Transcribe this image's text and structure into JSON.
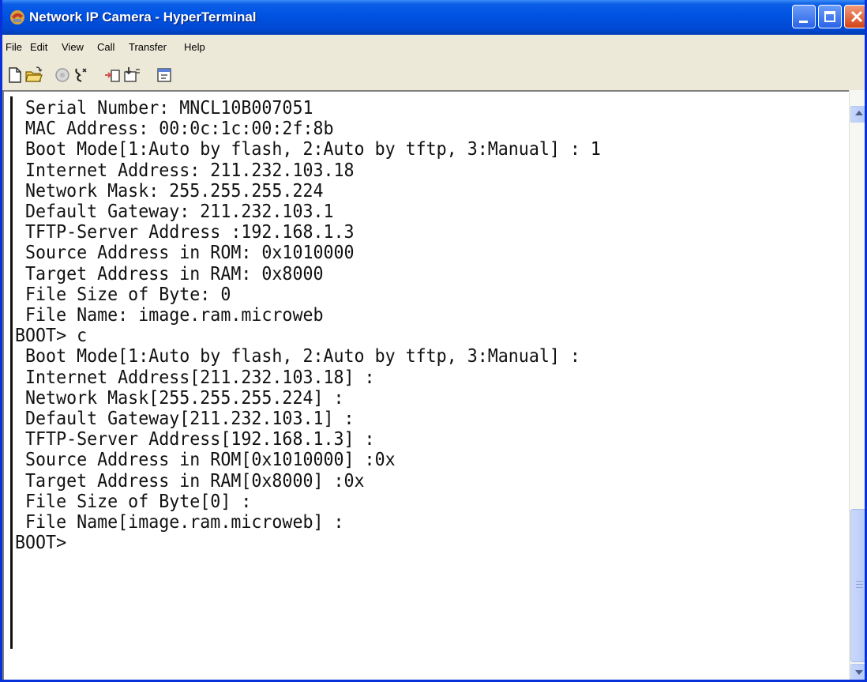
{
  "window": {
    "title": "Network IP Camera - HyperTerminal"
  },
  "menubar": {
    "items": [
      {
        "label": "File"
      },
      {
        "label": "Edit"
      },
      {
        "label": "View"
      },
      {
        "label": "Call"
      },
      {
        "label": "Transfer"
      },
      {
        "label": "Help"
      }
    ]
  },
  "toolbar": {
    "icons": [
      "new-connection-icon",
      "open-icon",
      "call-icon",
      "disconnect-icon",
      "send-icon",
      "receive-icon",
      "properties-icon"
    ]
  },
  "terminal": {
    "text": " Serial Number: MNCL10B007051\n MAC Address: 00:0c:1c:00:2f:8b\n Boot Mode[1:Auto by flash, 2:Auto by tftp, 3:Manual] : 1\n Internet Address: 211.232.103.18\n Network Mask: 255.255.255.224\n Default Gateway: 211.232.103.1\n TFTP-Server Address :192.168.1.3\n Source Address in ROM: 0x1010000\n Target Address in RAM: 0x8000\n File Size of Byte: 0\n File Name: image.ram.microweb\nBOOT> c\n Boot Mode[1:Auto by flash, 2:Auto by tftp, 3:Manual] :\n Internet Address[211.232.103.18] :\n Network Mask[255.255.255.224] :\n Default Gateway[211.232.103.1] :\n TFTP-Server Address[192.168.1.3] :\n Source Address in ROM[0x1010000] :0x\n Target Address in RAM[0x8000] :0x\n File Size of Byte[0] :\n File Name[image.ram.microweb] :\nBOOT>"
  },
  "colors": {
    "titlebar": "#0054e3",
    "close_button": "#d44317",
    "terminal_bg": "#ffffff",
    "terminal_fg": "#111111"
  }
}
